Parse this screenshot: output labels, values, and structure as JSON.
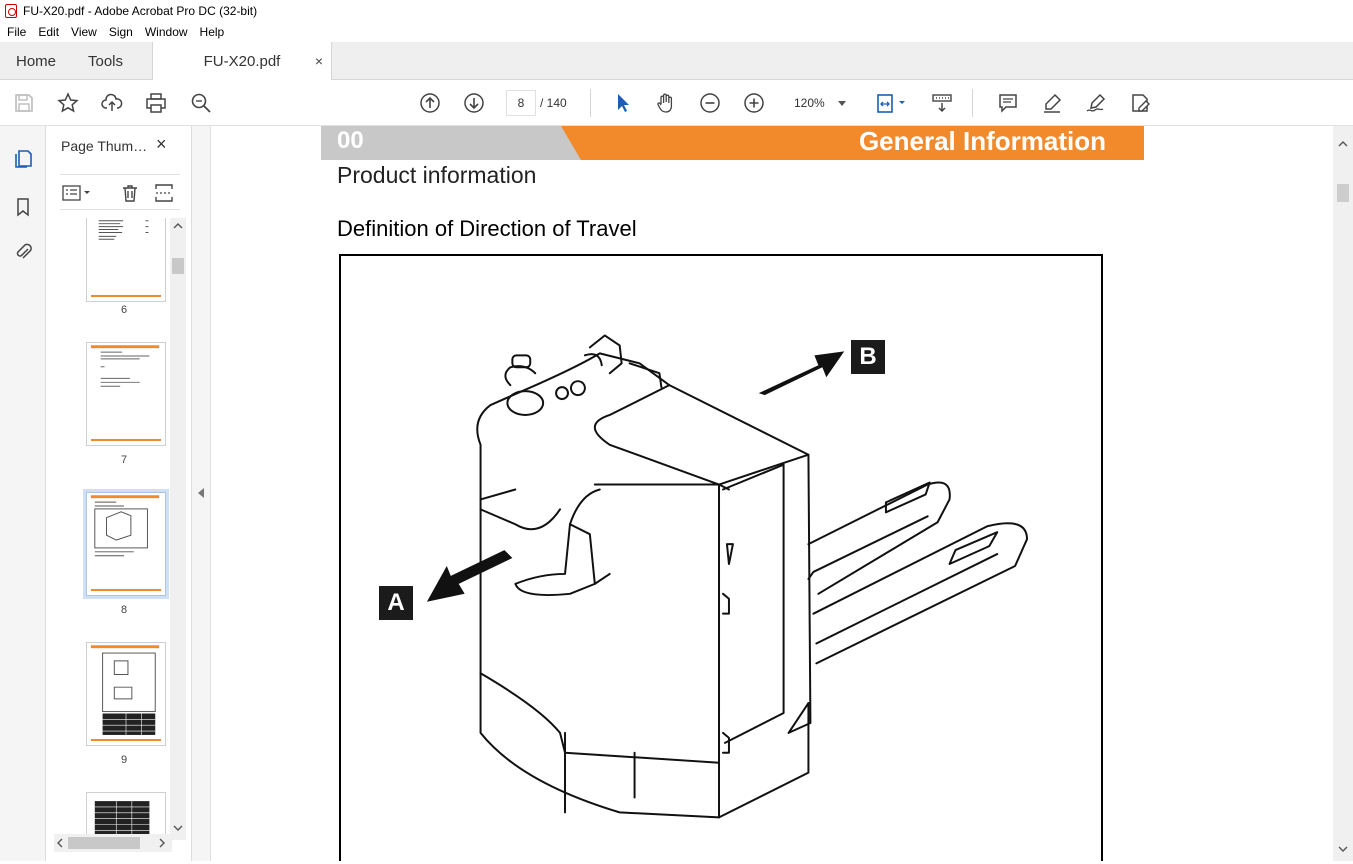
{
  "window": {
    "title": "FU-X20.pdf - Adobe Acrobat Pro DC (32-bit)"
  },
  "menu": [
    "File",
    "Edit",
    "View",
    "Sign",
    "Window",
    "Help"
  ],
  "tabs": {
    "home": "Home",
    "tools": "Tools",
    "document": "FU-X20.pdf",
    "close": "×"
  },
  "toolbar": {
    "page_current": "8",
    "page_total": "/ 140",
    "zoom": "120%"
  },
  "sidebar": {
    "panel_title": "Page Thum…",
    "close": "×",
    "thumbnails": [
      {
        "label": "6"
      },
      {
        "label": "7"
      },
      {
        "label": "8",
        "selected": true
      },
      {
        "label": "9"
      }
    ]
  },
  "document": {
    "section_number": "00",
    "section_title": "General Information",
    "subtitle": "Product information",
    "heading": "Definition of Direction of Travel",
    "figure_labels": {
      "a": "A",
      "b": "B"
    }
  },
  "colors": {
    "accent_orange": "#f28a2c",
    "header_gray": "#c8c8c8",
    "selection": "#cfe0f5"
  }
}
